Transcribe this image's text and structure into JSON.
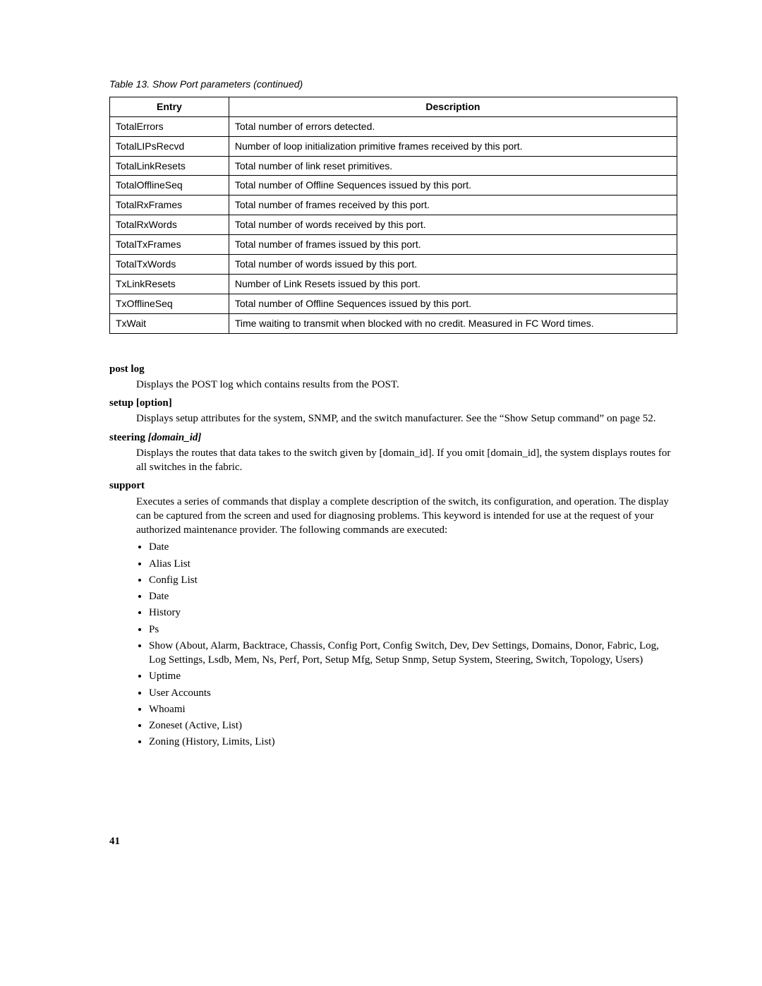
{
  "caption": "Table 13. Show Port parameters (continued)",
  "headers": {
    "entry": "Entry",
    "desc": "Description"
  },
  "rows": [
    {
      "entry": "TotalErrors",
      "desc": "Total number of errors detected."
    },
    {
      "entry": "TotalLIPsRecvd",
      "desc": "Number of loop initialization primitive frames received by this port."
    },
    {
      "entry": "TotalLinkResets",
      "desc": "Total number of link reset primitives."
    },
    {
      "entry": "TotalOfflineSeq",
      "desc": "Total number of Offline Sequences issued by this port."
    },
    {
      "entry": "TotalRxFrames",
      "desc": "Total number of frames received by this port."
    },
    {
      "entry": "TotalRxWords",
      "desc": "Total number of words received by this port."
    },
    {
      "entry": "TotalTxFrames",
      "desc": "Total number of frames issued by this port."
    },
    {
      "entry": "TotalTxWords",
      "desc": "Total number of words issued by this port."
    },
    {
      "entry": "TxLinkResets",
      "desc": "Number of Link Resets issued by this port."
    },
    {
      "entry": "TxOfflineSeq",
      "desc": "Total number of Offline Sequences issued by this port."
    },
    {
      "entry": "TxWait",
      "desc": "Time waiting to transmit when blocked with no credit. Measured in FC Word times."
    }
  ],
  "sections": {
    "postlog": {
      "term": "post log",
      "desc": "Displays the POST log which contains results from the POST."
    },
    "setup": {
      "term": "setup [option]",
      "desc": "Displays setup attributes for the system, SNMP, and the switch manufacturer. See the “Show Setup command” on page 52."
    },
    "steering": {
      "term": "steering ",
      "arg": "[domain_id]",
      "desc": "Displays the routes that data takes to the switch given by [domain_id]. If you omit [domain_id], the system displays routes for all switches in the fabric."
    },
    "support": {
      "term": "support",
      "desc": "Executes a series of commands that display a complete description of the switch, its configuration, and operation. The display can be captured from the screen and used for diagnosing problems. This keyword is intended for use at the request of your authorized maintenance provider. The following commands are executed:"
    }
  },
  "support_list": [
    "Date",
    "Alias List",
    "Config List",
    "Date",
    "History",
    "Ps",
    "Show (About, Alarm, Backtrace, Chassis, Config Port, Config Switch, Dev, Dev Settings, Domains, Donor, Fabric, Log, Log Settings, Lsdb, Mem, Ns, Perf, Port, Setup Mfg, Setup Snmp, Setup System, Steering, Switch, Topology, Users)",
    "Uptime",
    "User Accounts",
    "Whoami",
    "Zoneset (Active, List)",
    "Zoning (History, Limits, List)"
  ],
  "page_number": "41"
}
